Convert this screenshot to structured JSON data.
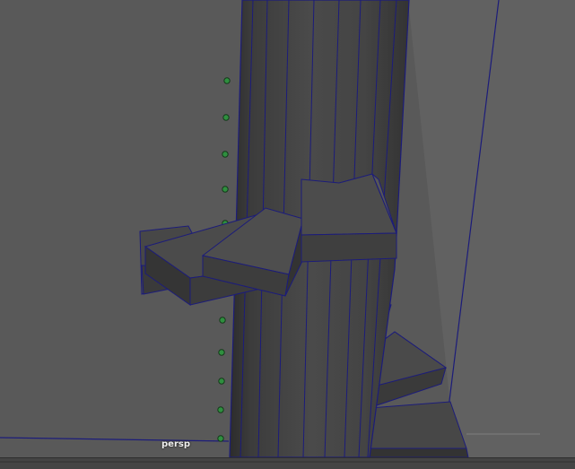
{
  "viewport": {
    "camera_label": "persp",
    "wire_color": "#1c1c7a",
    "pivot_color": "#2f8f3f",
    "icons": [
      "locator-icon"
    ]
  }
}
